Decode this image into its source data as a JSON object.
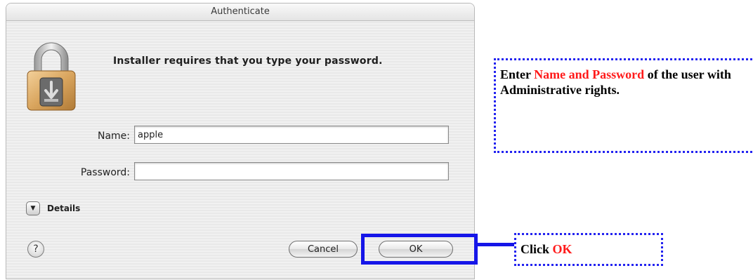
{
  "dialog": {
    "title": "Authenticate",
    "prompt": "Installer requires that you type your password.",
    "name_label": "Name:",
    "name_value": "apple",
    "password_label": "Password:",
    "password_value": "",
    "details_label": "Details",
    "help_label": "?",
    "cancel_label": "Cancel",
    "ok_label": "OK",
    "icon": "padlock-icon"
  },
  "annotations": {
    "auth_callout": {
      "prefix": "Enter ",
      "highlight": "Name and Password",
      "suffix": " of the user with Administrative rights."
    },
    "ok_callout": {
      "prefix": "Click ",
      "highlight": "OK"
    },
    "colors": {
      "annotation_blue": "#1515e8",
      "highlight_red": "#ff1a1a"
    }
  }
}
